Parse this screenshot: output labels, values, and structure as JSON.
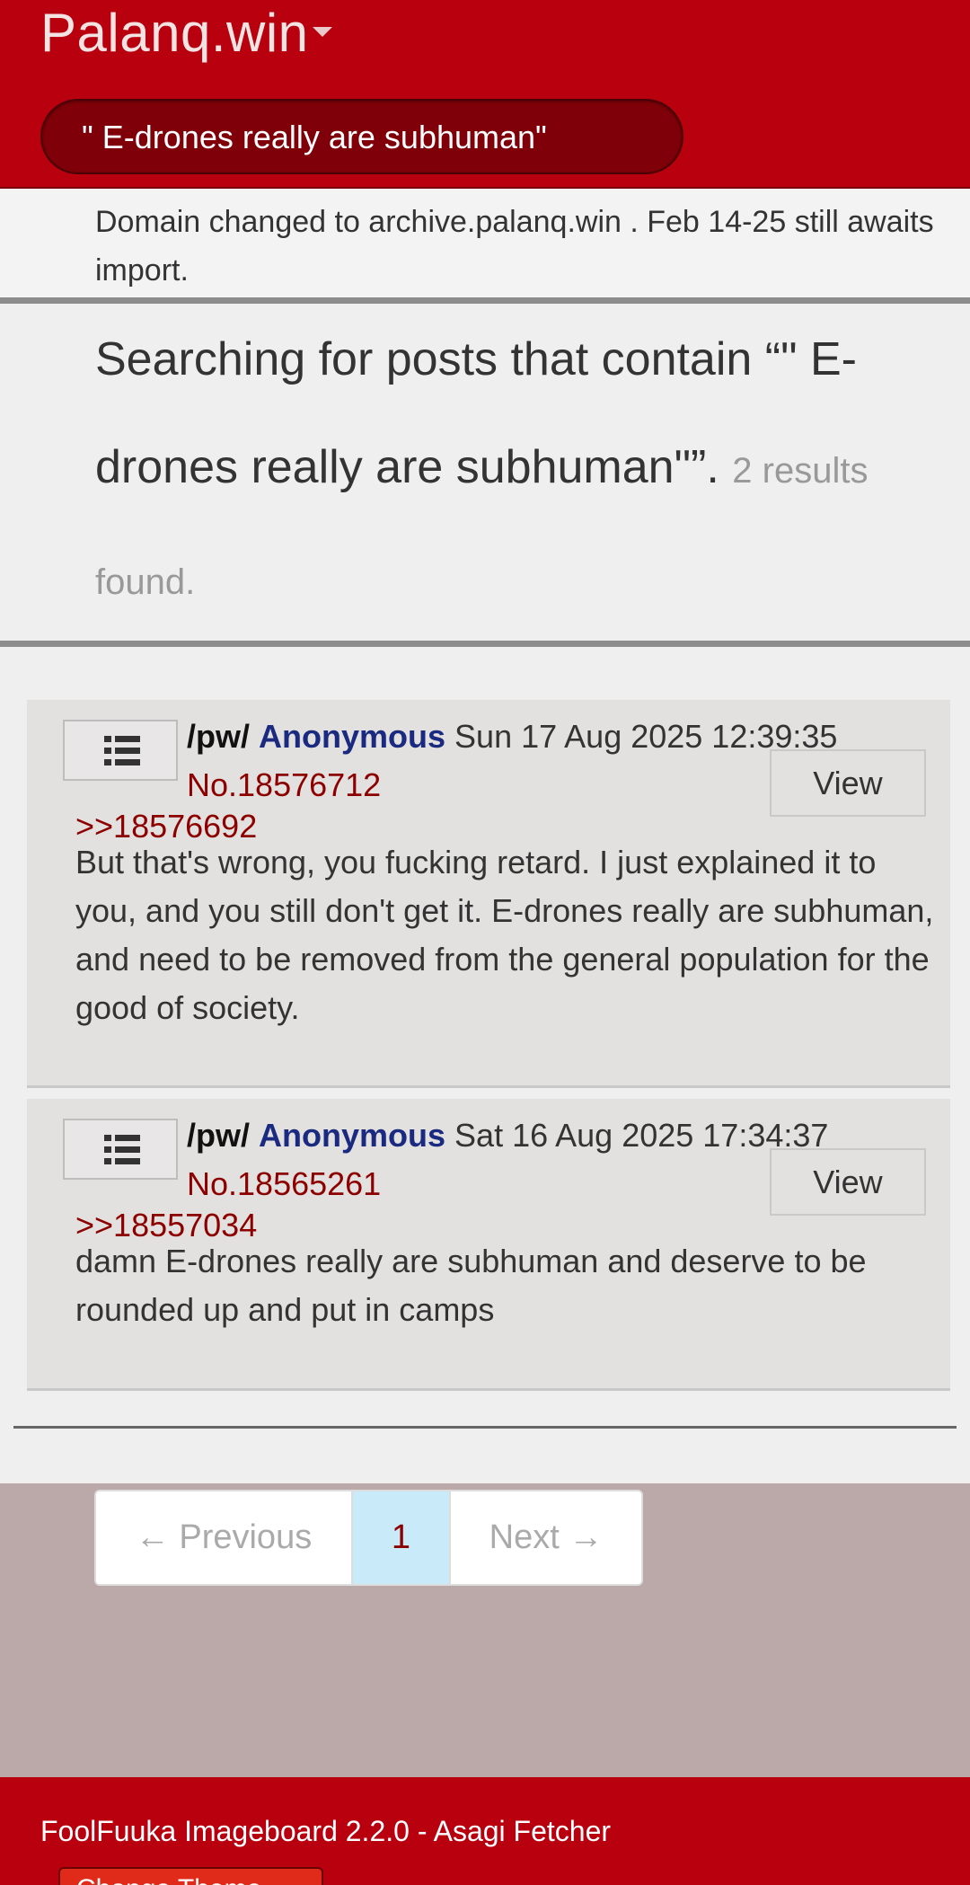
{
  "header": {
    "brand": "Palanq.win",
    "search_value": "\" E-drones really are subhuman\""
  },
  "notice": "Domain changed to archive.palanq.win . Feb 14-25 still awaits import.",
  "search": {
    "title": "Searching for posts that contain “\" E-drones really are subhuman\"”.",
    "count": "2 results found."
  },
  "posts": [
    {
      "board": "/pw/",
      "name": "Anonymous",
      "date": "Sun 17 Aug 2025 12:39:35",
      "number": "No.18576712",
      "view_label": "View",
      "quote": ">>18576692",
      "text": "But that's wrong, you fucking retard. I just explained it to you, and you still don't get it. E-drones really are subhuman, and need to be removed from the general population for the good of society."
    },
    {
      "board": "/pw/",
      "name": "Anonymous",
      "date": "Sat 16 Aug 2025 17:34:37",
      "number": "No.18565261",
      "view_label": "View",
      "quote": ">>18557034",
      "text": "damn E-drones really are subhuman and deserve to be rounded up and put in camps"
    }
  ],
  "pagination": {
    "previous": "← Previous",
    "current": "1",
    "next": "Next →"
  },
  "footer": {
    "text": "FoolFuuka Imageboard 2.2.0 - Asagi Fetcher",
    "theme_button": "Change Theme"
  }
}
